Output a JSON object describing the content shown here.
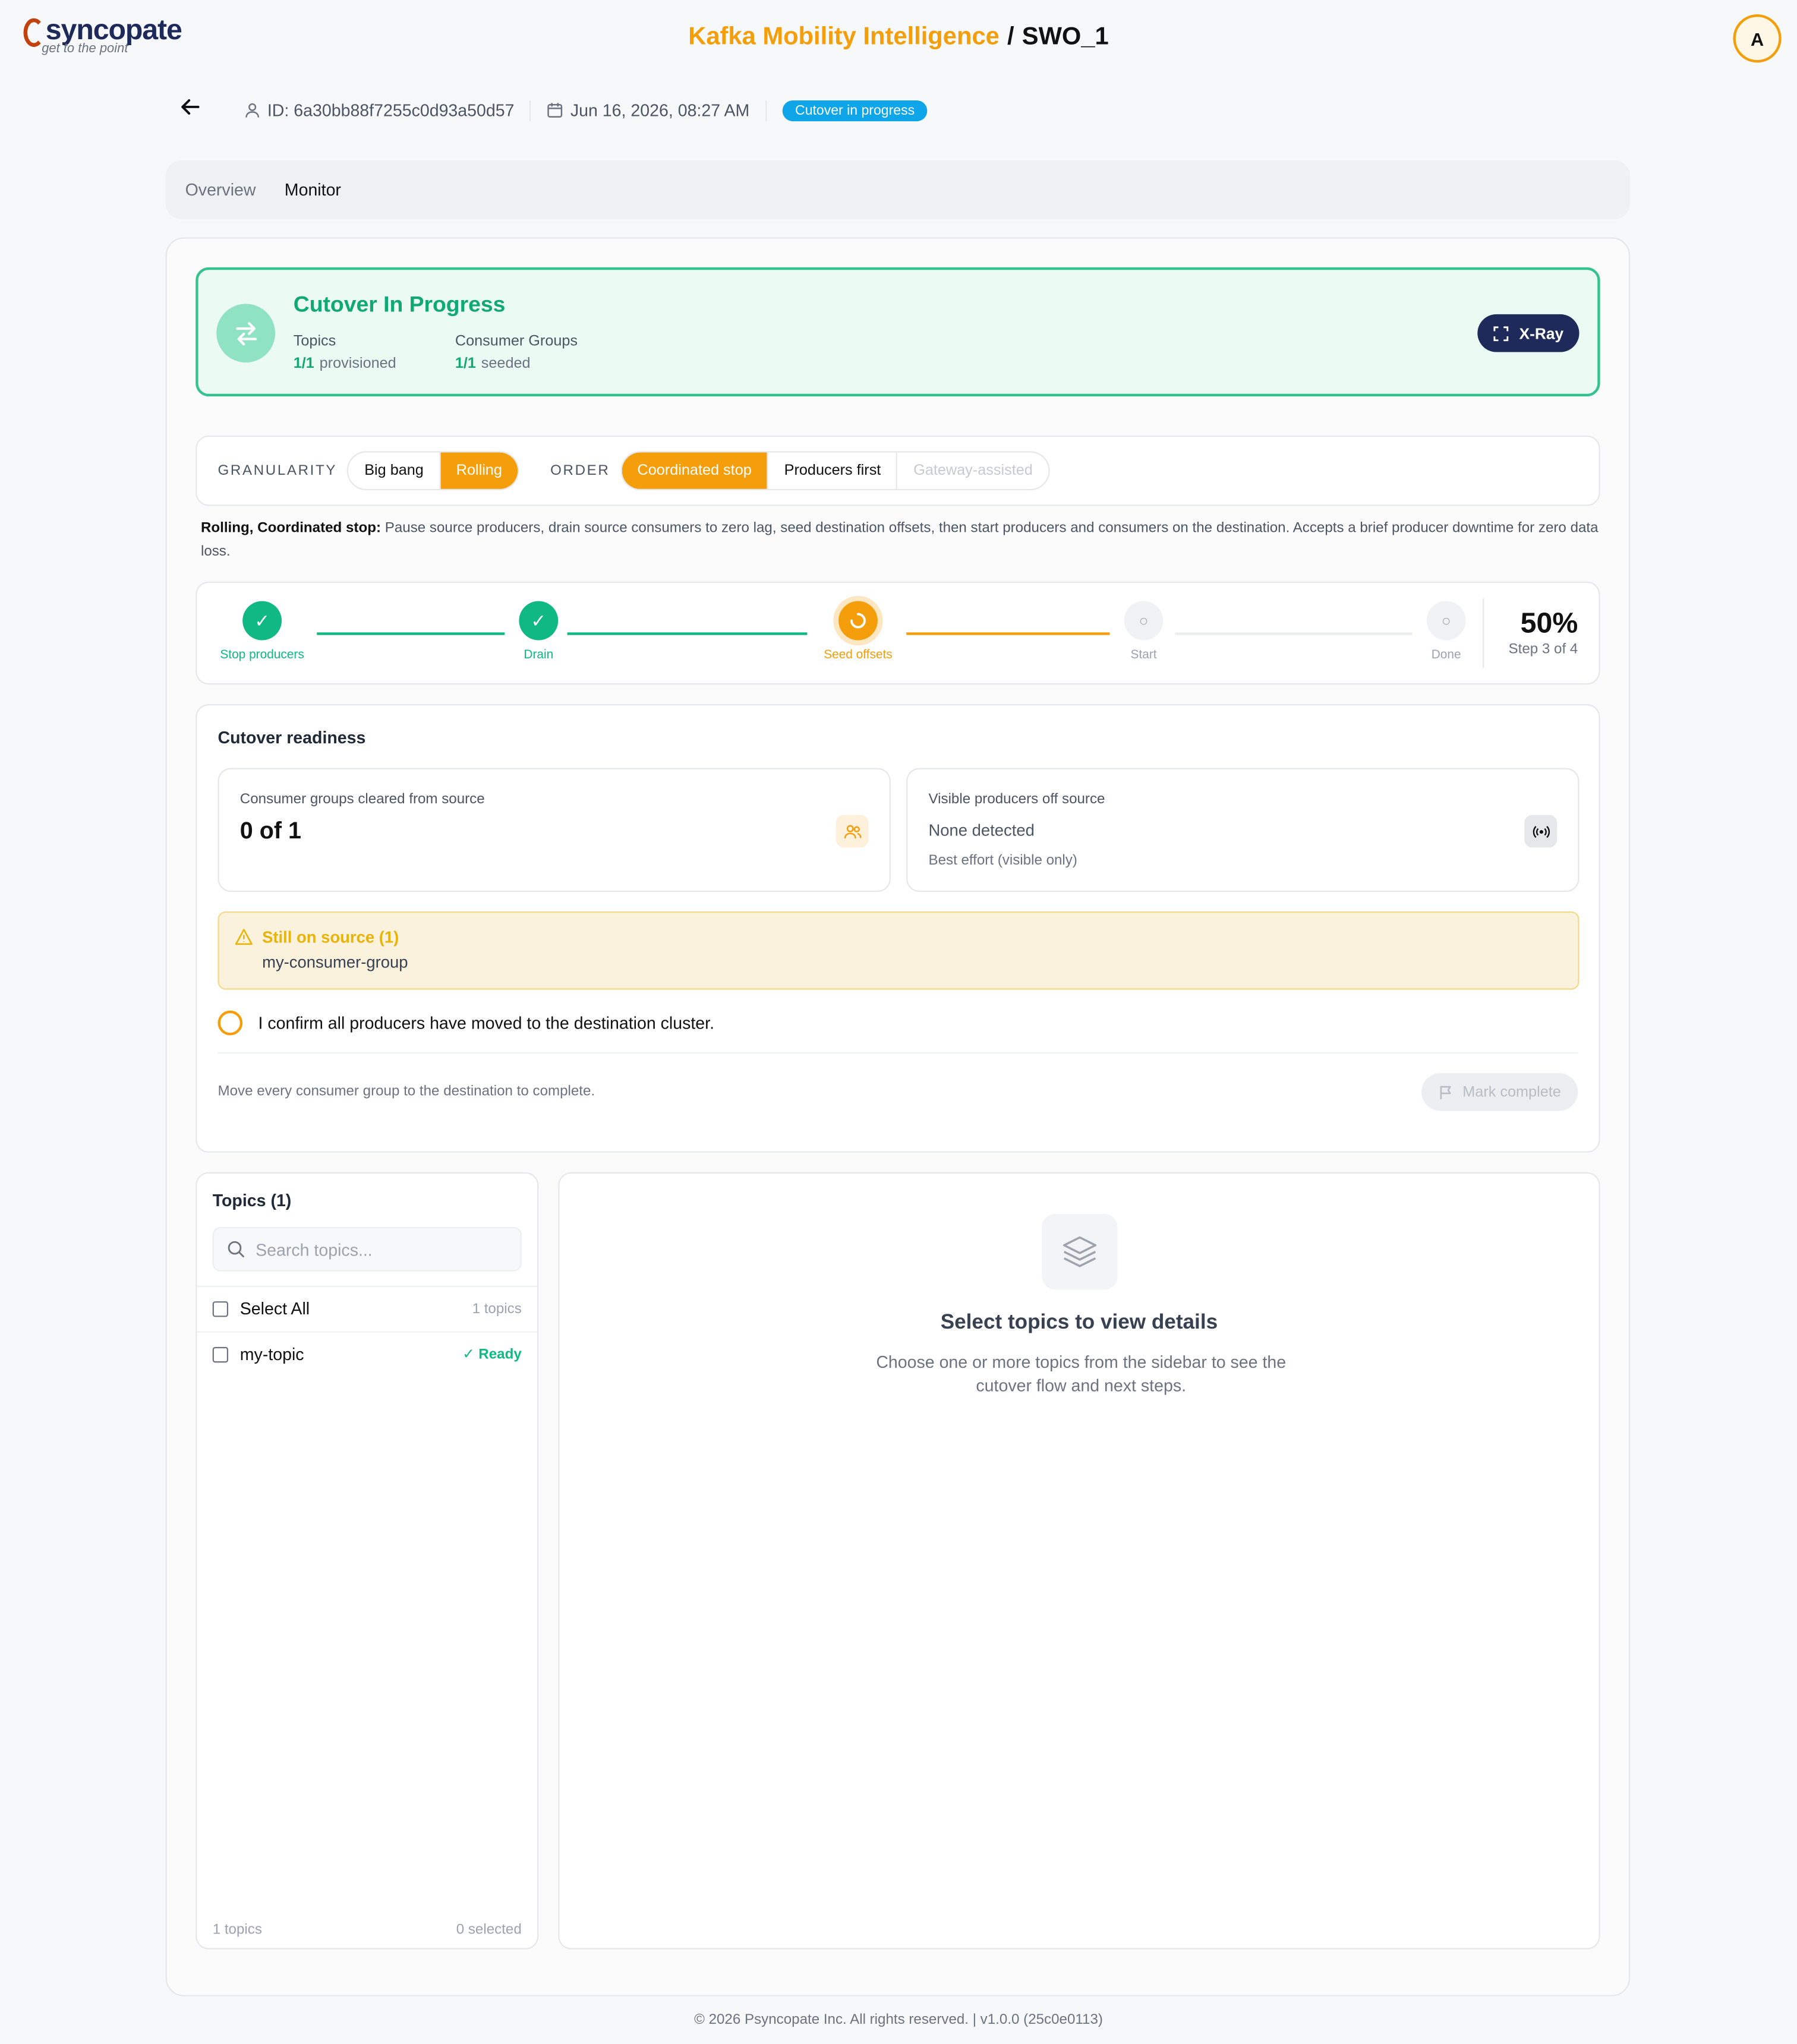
{
  "header": {
    "brand": "syncopate",
    "tagline": "get to the point",
    "app_title": "Kafka Mobility Intelligence",
    "separator": "/",
    "page_name": "SWO_1",
    "avatar_letter": "A"
  },
  "meta": {
    "id_label": "ID: 6a30bb88f7255c0d93a50d57",
    "date": "Jun 16, 2026, 08:27 AM",
    "status_badge": "Cutover in progress"
  },
  "tabs": [
    {
      "label": "Overview",
      "active": false
    },
    {
      "label": "Monitor",
      "active": true
    }
  ],
  "status_card": {
    "title": "Cutover In Progress",
    "topics_label": "Topics",
    "topics_value": "1/1",
    "topics_unit": "provisioned",
    "groups_label": "Consumer Groups",
    "groups_value": "1/1",
    "groups_unit": "seeded",
    "xray_label": "X-Ray"
  },
  "strategy": {
    "granularity_label": "GRANULARITY",
    "granularity_options": [
      "Big bang",
      "Rolling"
    ],
    "granularity_selected": "Rolling",
    "order_label": "ORDER",
    "order_options": [
      "Coordinated stop",
      "Producers first",
      "Gateway-assisted"
    ],
    "order_selected": "Coordinated stop",
    "description_bold": "Rolling, Coordinated stop:",
    "description": "Pause source producers, drain source consumers to zero lag, seed destination offsets, then start producers and consumers on the destination. Accepts a brief producer downtime for zero data loss."
  },
  "stepper": {
    "steps": [
      {
        "label": "Stop producers",
        "state": "done"
      },
      {
        "label": "Drain",
        "state": "done"
      },
      {
        "label": "Seed offsets",
        "state": "current"
      },
      {
        "label": "Start",
        "state": "todo"
      },
      {
        "label": "Done",
        "state": "todo"
      }
    ],
    "percent": "50%",
    "step_text": "Step 3 of 4"
  },
  "readiness": {
    "title": "Cutover readiness",
    "card1_title": "Consumer groups cleared from source",
    "card1_value": "0 of 1",
    "card2_title": "Visible producers off source",
    "card2_value": "None detected",
    "card2_note": "Best effort (visible only)",
    "warning_title": "Still on source (1)",
    "warning_item": "my-consumer-group",
    "confirm_text": "I confirm all producers have moved to the destination cluster.",
    "footnote": "Move every consumer group to the destination to complete.",
    "mark_complete": "Mark complete"
  },
  "topics_panel": {
    "title": "Topics (1)",
    "search_placeholder": "Search topics...",
    "select_all": "Select All",
    "select_all_count": "1 topics",
    "items": [
      {
        "name": "my-topic",
        "status": "Ready"
      }
    ],
    "footer_count": "1 topics",
    "footer_selected": "0 selected"
  },
  "detail": {
    "title": "Select topics to view details",
    "description": "Choose one or more topics from the sidebar to see the cutover flow and next steps."
  },
  "footer": {
    "copyright": "© 2026 Psyncopate Inc. All rights reserved. | v1.0.0 (25c0e0113)"
  },
  "colors": {
    "accent": "#f59e0b",
    "success": "#10b981",
    "navy": "#1e2a5a",
    "badge_blue": "#0ea5e9"
  }
}
